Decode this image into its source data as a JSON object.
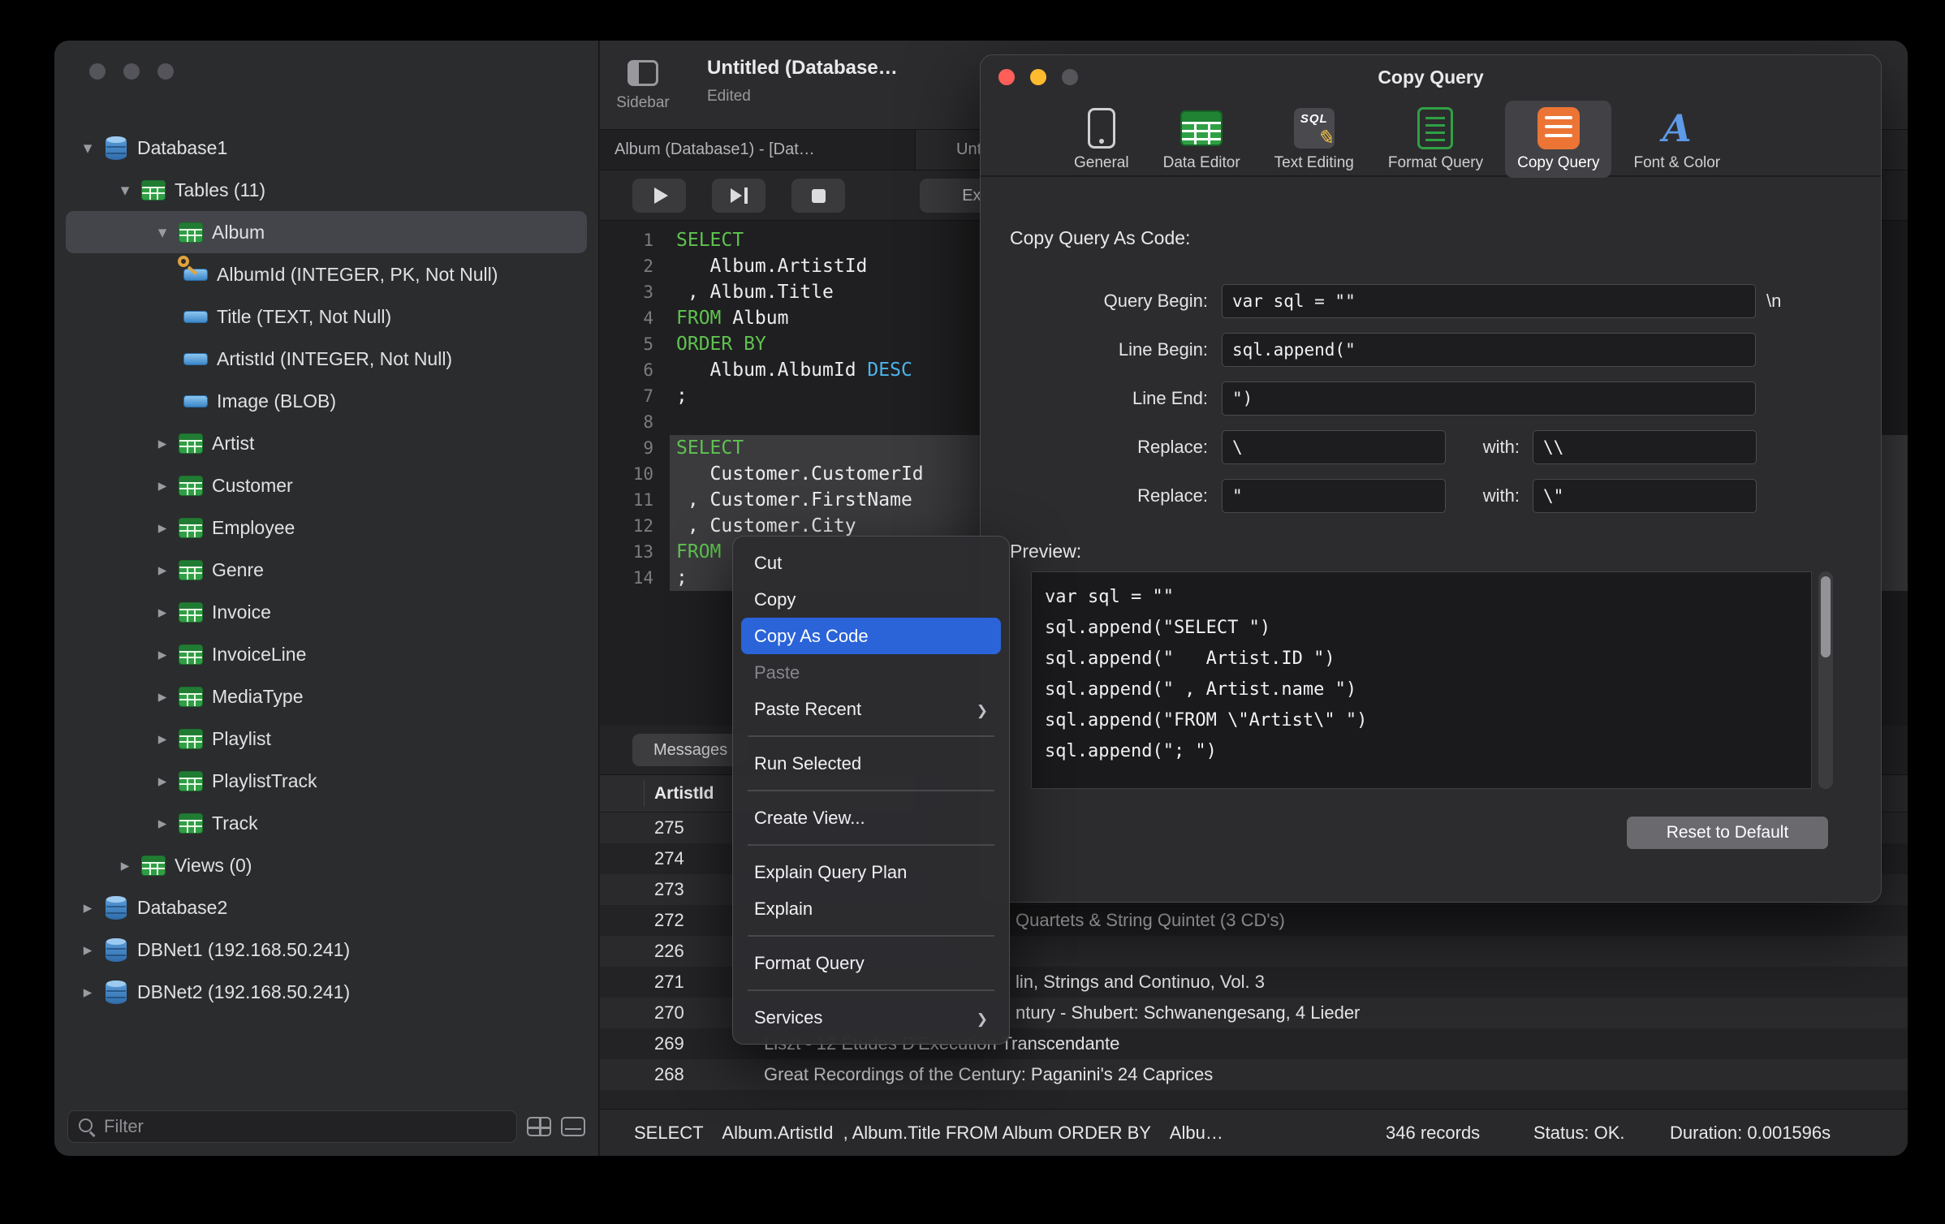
{
  "sidebar": {
    "filter_placeholder": "Filter",
    "tree": [
      {
        "cls": "lvl0",
        "chev": "down",
        "icon": "ic-db",
        "label": "Database1"
      },
      {
        "cls": "lvl1",
        "chev": "down",
        "icon": "ic-table",
        "label": "Tables (11)"
      },
      {
        "cls": "lvl2 sel",
        "chev": "down",
        "icon": "ic-table",
        "label": "Album"
      },
      {
        "cls": "lvl3",
        "icon": "ic-col",
        "pk": true,
        "label": "AlbumId (INTEGER, PK, Not Null)"
      },
      {
        "cls": "lvl3",
        "icon": "ic-col",
        "label": "Title (TEXT, Not Null)"
      },
      {
        "cls": "lvl3",
        "icon": "ic-col",
        "label": "ArtistId (INTEGER, Not Null)"
      },
      {
        "cls": "lvl3",
        "icon": "ic-col",
        "label": "Image (BLOB)"
      },
      {
        "cls": "lvl2",
        "chev": "right",
        "icon": "ic-table",
        "label": "Artist"
      },
      {
        "cls": "lvl2",
        "chev": "right",
        "icon": "ic-table",
        "label": "Customer"
      },
      {
        "cls": "lvl2",
        "chev": "right",
        "icon": "ic-table",
        "label": "Employee"
      },
      {
        "cls": "lvl2",
        "chev": "right",
        "icon": "ic-table",
        "label": "Genre"
      },
      {
        "cls": "lvl2",
        "chev": "right",
        "icon": "ic-table",
        "label": "Invoice"
      },
      {
        "cls": "lvl2",
        "chev": "right",
        "icon": "ic-table",
        "label": "InvoiceLine"
      },
      {
        "cls": "lvl2",
        "chev": "right",
        "icon": "ic-table",
        "label": "MediaType"
      },
      {
        "cls": "lvl2",
        "chev": "right",
        "icon": "ic-table",
        "label": "Playlist"
      },
      {
        "cls": "lvl2",
        "chev": "right",
        "icon": "ic-table",
        "label": "PlaylistTrack"
      },
      {
        "cls": "lvl2",
        "chev": "right",
        "icon": "ic-table",
        "label": "Track"
      },
      {
        "cls": "lvl1",
        "chev": "right",
        "icon": "ic-table",
        "label": "Views (0)"
      },
      {
        "cls": "lvl0",
        "chev": "right",
        "icon": "ic-db",
        "label": "Database2"
      },
      {
        "cls": "lvl0",
        "chev": "right",
        "icon": "ic-dbnet",
        "label": "DBNet1 (192.168.50.241)"
      },
      {
        "cls": "lvl0",
        "chev": "right",
        "icon": "ic-dbnet",
        "label": "DBNet2 (192.168.50.241)"
      }
    ]
  },
  "editor_window": {
    "sidebar_button_label": "Sidebar",
    "title": "Untitled (Database…",
    "subtitle": "Edited",
    "tab1": "Album (Database1) - [Dat…",
    "tab2": "Untitled",
    "explain_label": "Explain",
    "messages_tab_label": "Messages",
    "lines": [
      {
        "n": "1",
        "text": "SELECT"
      },
      {
        "n": "2",
        "text": "   Album.ArtistId"
      },
      {
        "n": "3",
        "text": " , Album.Title"
      },
      {
        "n": "4",
        "text": "FROM Album"
      },
      {
        "n": "5",
        "text": "ORDER BY"
      },
      {
        "n": "6",
        "text": "   Album.AlbumId DESC"
      },
      {
        "n": "7",
        "text": ";"
      },
      {
        "n": "8",
        "text": ""
      },
      {
        "n": "9",
        "text": "SELECT",
        "cls": "sel"
      },
      {
        "n": "10",
        "text": "   Customer.CustomerId",
        "cls": "sel"
      },
      {
        "n": "11",
        "text": " , Customer.FirstName",
        "cls": "sel"
      },
      {
        "n": "12",
        "text": " , Customer.City",
        "cls": "sel"
      },
      {
        "n": "13",
        "text": "FROM ",
        "cls": "sel"
      },
      {
        "n": "14",
        "text": ";",
        "cls": "sel"
      }
    ]
  },
  "results": {
    "columns": [
      "ArtistId"
    ],
    "rows": [
      {
        "num": "275",
        "title": ""
      },
      {
        "num": "274",
        "title": ""
      },
      {
        "num": "273",
        "title": ""
      },
      {
        "num": "272",
        "title": "Quartets & String Quintet (3 CD's)",
        "cls": "cut"
      },
      {
        "num": "226",
        "title": ""
      },
      {
        "num": "271",
        "title": "lin, Strings and Continuo, Vol. 3",
        "cls": "cut"
      },
      {
        "num": "270",
        "title": "ntury - Shubert: Schwanengesang, 4 Lieder",
        "cls": "cut"
      },
      {
        "num": "269",
        "title": "Liszt - 12 Études D'Execution Transcendante"
      },
      {
        "num": "268",
        "title": "Great Recordings of the Century: Paganini's 24 Caprices"
      }
    ]
  },
  "statusbar": {
    "query": "SELECT    Album.ArtistId  , Album.Title FROM Album ORDER BY    Albu…",
    "records": "346 records",
    "status": "Status: OK.",
    "duration": "Duration: 0.001596s"
  },
  "context_menu": {
    "items": [
      {
        "label": "Cut"
      },
      {
        "label": "Copy"
      },
      {
        "label": "Copy As Code",
        "cls": "hl"
      },
      {
        "label": "Paste",
        "cls": "dis"
      },
      {
        "label": "Paste Recent",
        "submenu": true
      },
      {
        "sep": true
      },
      {
        "label": "Run Selected"
      },
      {
        "sep": true
      },
      {
        "label": "Create View..."
      },
      {
        "sep": true
      },
      {
        "label": "Explain Query Plan"
      },
      {
        "label": "Explain"
      },
      {
        "sep": true
      },
      {
        "label": "Format Query"
      },
      {
        "sep": true
      },
      {
        "label": "Services",
        "submenu": true
      }
    ]
  },
  "dialog": {
    "title": "Copy Query",
    "toolbar": [
      {
        "icon": "tb-general",
        "label": "General"
      },
      {
        "icon": "tb-data",
        "label": "Data Editor"
      },
      {
        "icon": "tb-text",
        "label": "Text Editing"
      },
      {
        "icon": "tb-format",
        "label": "Format Query"
      },
      {
        "icon": "tb-copy",
        "label": "Copy Query",
        "cls": "sel"
      },
      {
        "icon": "tb-font",
        "label": "Font & Color"
      }
    ],
    "section_label": "Copy Query As Code:",
    "form": {
      "query_begin_label": "Query Begin:",
      "query_begin_value": "var sql = \"\"",
      "query_begin_suffix": "\\n",
      "line_begin_label": "Line Begin:",
      "line_begin_value": "sql.append(\"",
      "line_end_label": "Line End:",
      "line_end_value": "\")",
      "replace1_label": "Replace:",
      "replace1_value": "\\",
      "replace1_with_label": "with:",
      "replace1_with_value": "\\\\",
      "replace2_label": "Replace:",
      "replace2_value": "\"",
      "replace2_with_label": "with:",
      "replace2_with_value": "\\\""
    },
    "preview_label": "Preview:",
    "preview_lines": [
      "var sql = \"\"",
      "sql.append(\"SELECT \")",
      "sql.append(\"   Artist.ID \")",
      "sql.append(\" , Artist.name \")",
      "sql.append(\"FROM \\\"Artist\\\" \")",
      "sql.append(\"; \")"
    ],
    "reset_button": "Reset to Default"
  },
  "colors": {
    "accent_blue": "#2b63d9",
    "keyword_green": "#5fc24f",
    "keyword_blue": "#4db4ec",
    "copy_icon_orange": "#ec7434"
  }
}
